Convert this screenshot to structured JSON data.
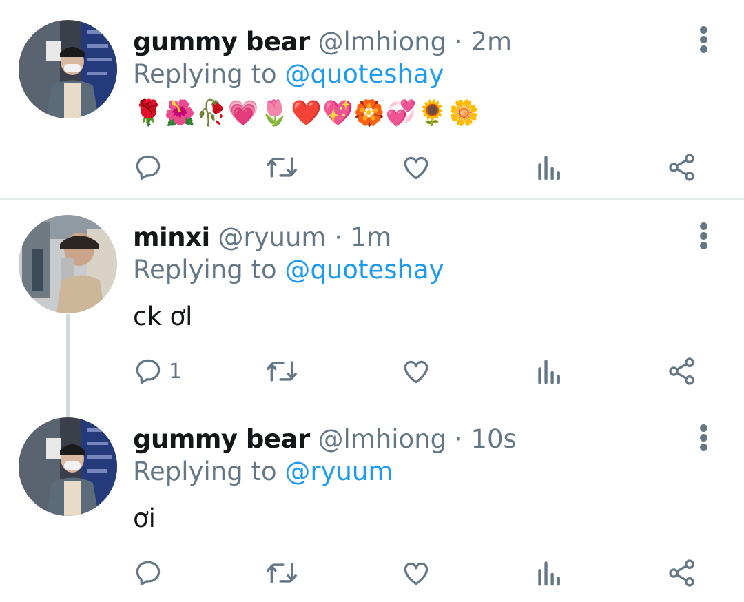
{
  "tweets": [
    {
      "name": "gummy bear",
      "handle": "@lmhiong",
      "separator": "·",
      "time": "2m",
      "replying_prefix": "Replying to",
      "replying_to": "@quoteshay",
      "text": "🌹🌺🥀💗🌷❤️💖🏵️💞🌻🌼",
      "reply_count": ""
    },
    {
      "name": "minxi",
      "handle": "@ryuum",
      "separator": "·",
      "time": "1m",
      "replying_prefix": "Replying to",
      "replying_to": "@quoteshay",
      "text": "ck ơl",
      "reply_count": "1"
    },
    {
      "name": "gummy bear",
      "handle": "@lmhiong",
      "separator": "·",
      "time": "10s",
      "replying_prefix": "Replying to",
      "replying_to": "@ryuum",
      "text": "ơi",
      "reply_count": ""
    }
  ],
  "icons": [
    "reply-icon",
    "retweet-icon",
    "like-icon",
    "analytics-icon",
    "share-icon",
    "more-options-icon"
  ],
  "colors": {
    "mention": "#1d9bf0",
    "secondary_text": "#657786",
    "divider": "#e6ecf0"
  }
}
